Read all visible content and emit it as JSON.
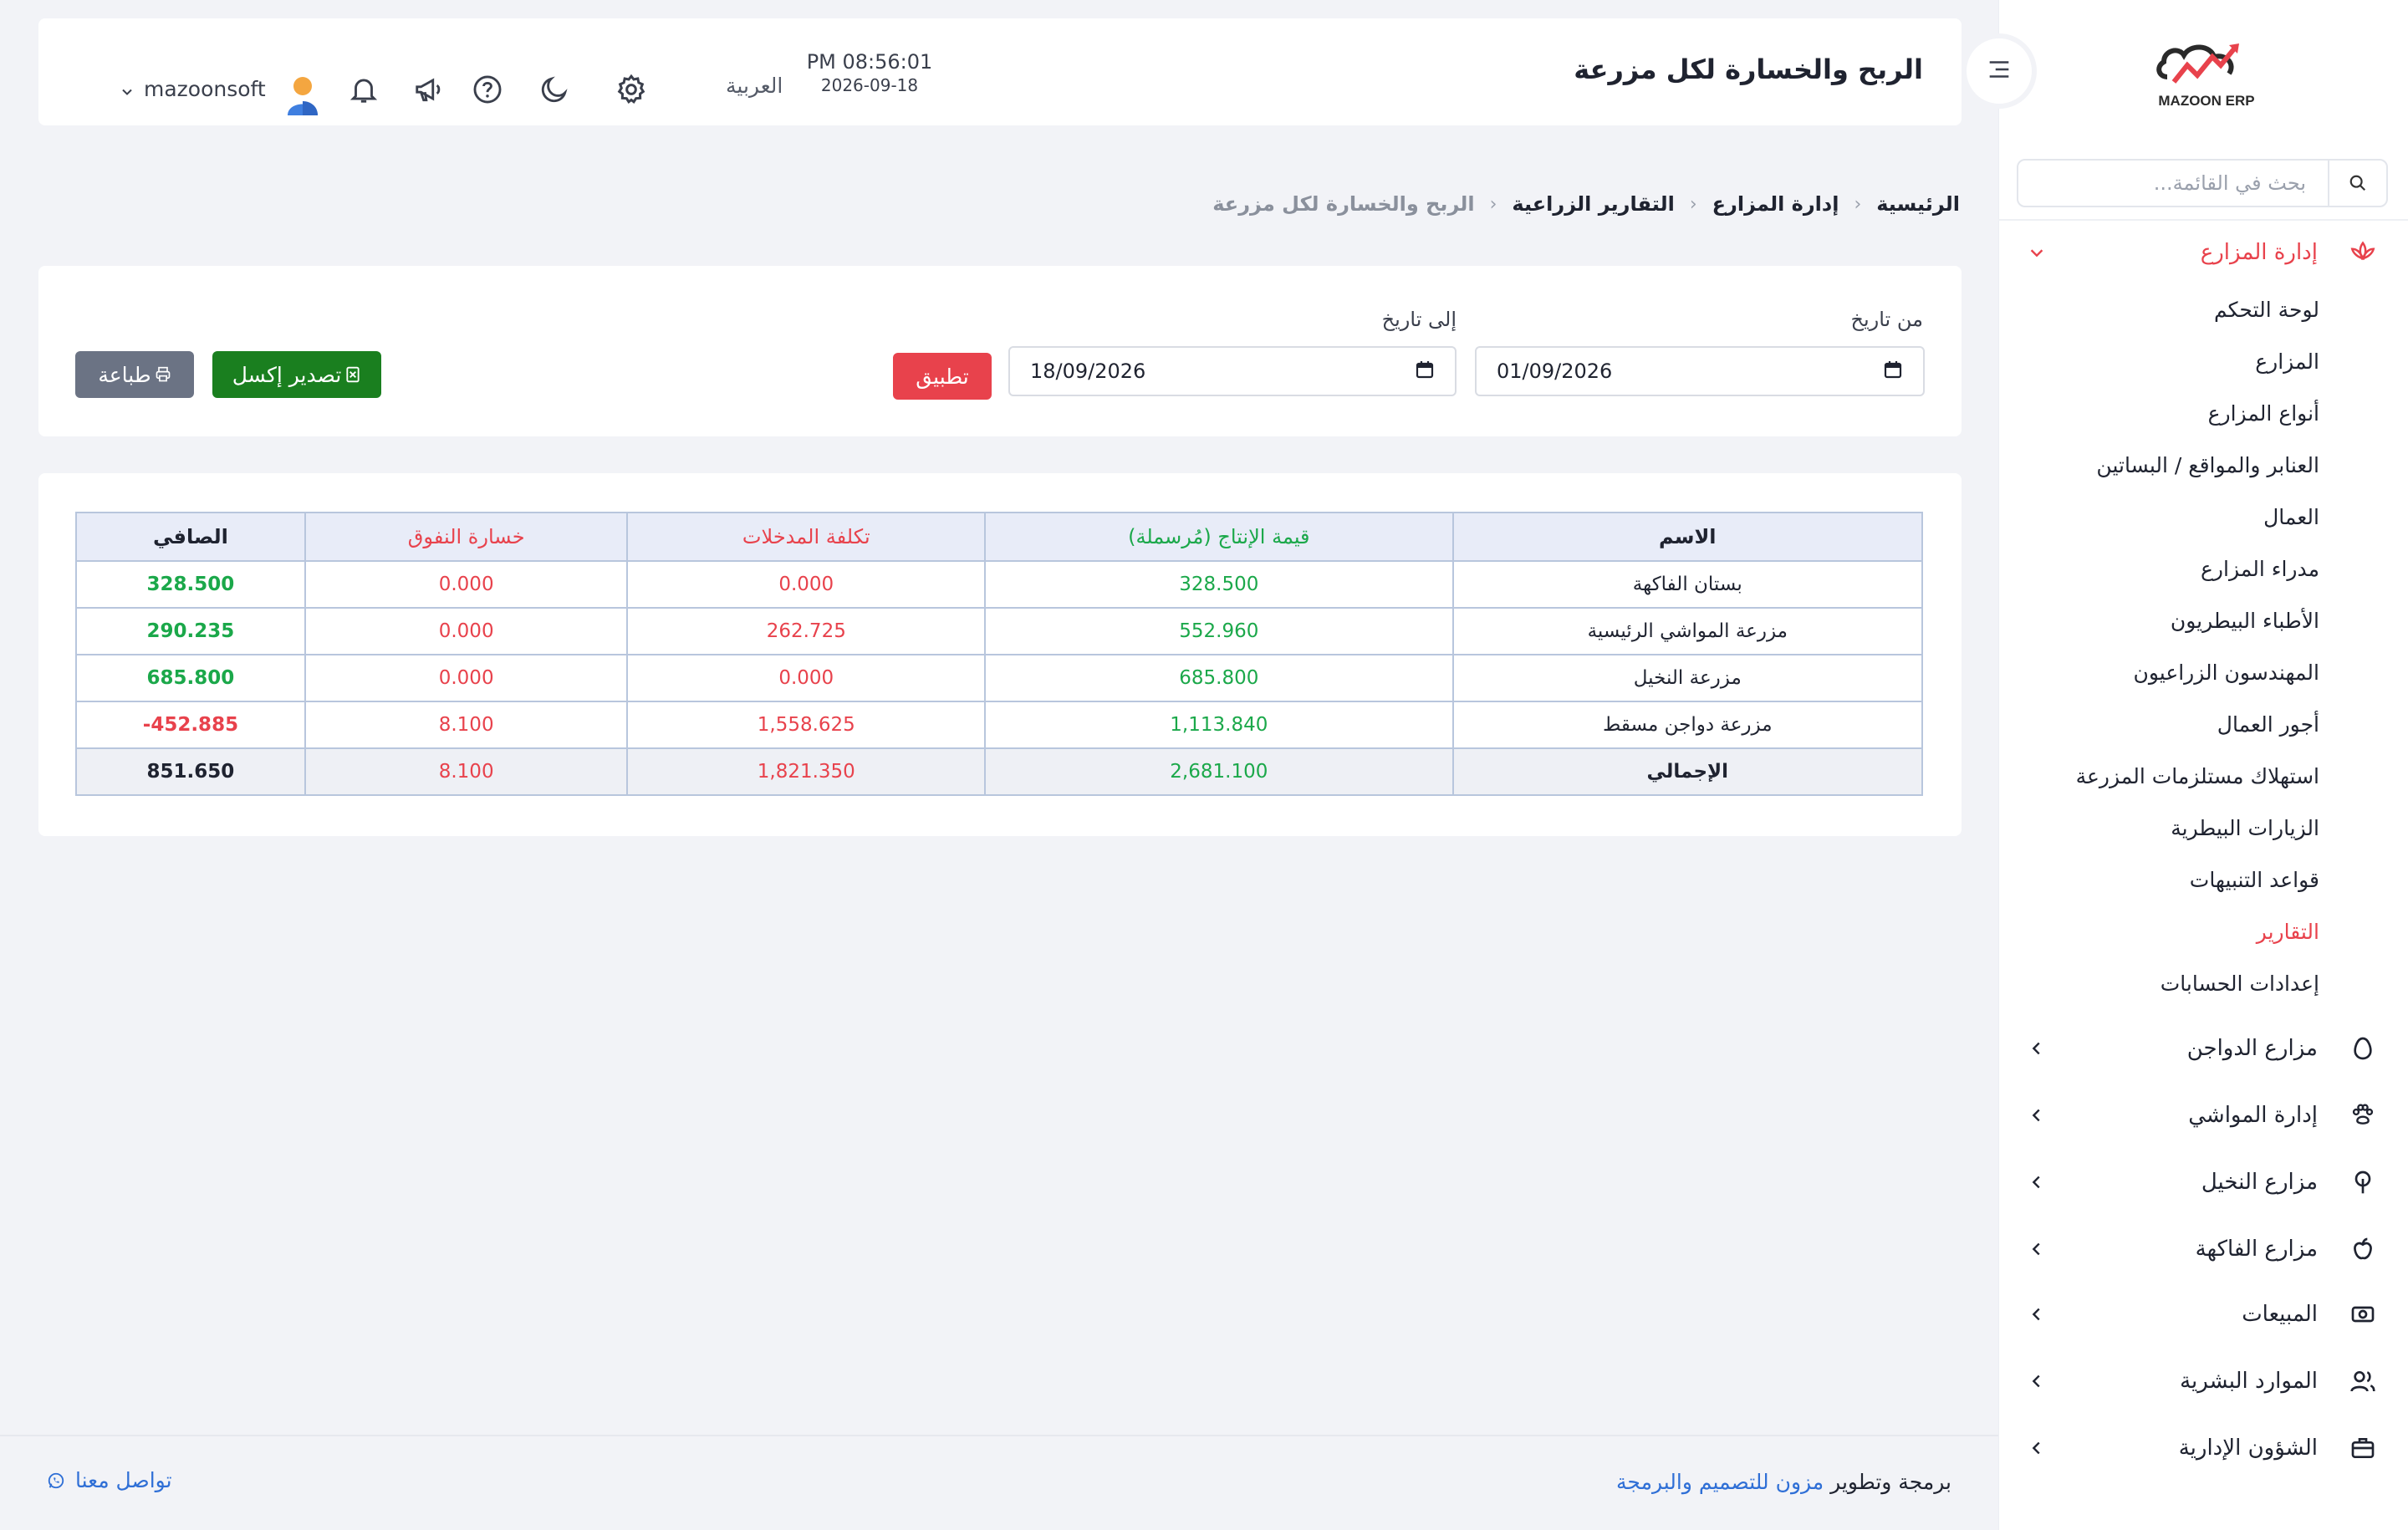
{
  "header": {
    "title": "الربح والخسارة لكل مزرعة",
    "time": "PM 08:56:01",
    "date": "2026-09-18",
    "language": "العربية",
    "username": "mazoonsoft"
  },
  "logo": {
    "text": "MAZOON ERP"
  },
  "sidebar": {
    "search_placeholder": "بحث في القائمة...",
    "sections": [
      {
        "label": "إدارة المزارع",
        "icon": "lotus-icon",
        "expanded": true,
        "active": true
      },
      {
        "label": "مزارع الدواجن",
        "icon": "egg-icon"
      },
      {
        "label": "إدارة المواشي",
        "icon": "paw-icon"
      },
      {
        "label": "مزارع النخيل",
        "icon": "tree-icon"
      },
      {
        "label": "مزارع الفاكهة",
        "icon": "apple-icon"
      },
      {
        "label": "المبيعات",
        "icon": "cash-icon"
      },
      {
        "label": "الموارد البشرية",
        "icon": "users-icon"
      },
      {
        "label": "الشؤون الإدارية",
        "icon": "briefcase-icon"
      }
    ],
    "submenu": [
      "لوحة التحكم",
      "المزارع",
      "أنواع المزارع",
      "العنابر والمواقع / البساتين",
      "العمال",
      "مدراء المزارع",
      "الأطباء البيطريون",
      "المهندسون الزراعيون",
      "أجور العمال",
      "استهلاك مستلزمات المزرعة",
      "الزيارات البيطرية",
      "قواعد التنبيهات",
      "التقارير",
      "إعدادات الحسابات"
    ],
    "active_submenu": "التقارير"
  },
  "breadcrumb": [
    "الرئيسية",
    "إدارة المزارع",
    "التقارير الزراعية",
    "الربح والخسارة لكل مزرعة"
  ],
  "filters": {
    "from_label": "من تاريخ",
    "from_value": "01/09/2026",
    "to_label": "إلى تاريخ",
    "to_value": "18/09/2026",
    "apply_label": "تطبيق",
    "excel_label": "تصدير إكسل",
    "print_label": "طباعة"
  },
  "table": {
    "headers": {
      "name": "الاسم",
      "production": "قيمة الإنتاج (مُرسملة)",
      "input_cost": "تكلفة المدخلات",
      "mortality_loss": "خسارة النفوق",
      "net": "الصافي"
    },
    "rows": [
      {
        "name": "بستان الفاكهة",
        "production": "328.500",
        "input_cost": "0.000",
        "mortality_loss": "0.000",
        "net": "328.500",
        "net_negative": false
      },
      {
        "name": "مزرعة المواشي الرئيسية",
        "production": "552.960",
        "input_cost": "262.725",
        "mortality_loss": "0.000",
        "net": "290.235",
        "net_negative": false
      },
      {
        "name": "مزرعة النخيل",
        "production": "685.800",
        "input_cost": "0.000",
        "mortality_loss": "0.000",
        "net": "685.800",
        "net_negative": false
      },
      {
        "name": "مزرعة دواجن مسقط",
        "production": "1,113.840",
        "input_cost": "1,558.625",
        "mortality_loss": "8.100",
        "net": "452.885-",
        "net_negative": true
      }
    ],
    "total": {
      "name": "الإجمالي",
      "production": "2,681.100",
      "input_cost": "1,821.350",
      "mortality_loss": "8.100",
      "net": "851.650"
    }
  },
  "footer": {
    "credit_prefix": "برمجة وتطوير",
    "credit_link": "مزون للتصميم والبرمجة",
    "contact": "تواصل معنا"
  },
  "colors": {
    "accent_red": "#e8424c",
    "green": "#1ba84a",
    "excel_green": "#1a7f1f",
    "print_gray": "#6b7384",
    "link_blue": "#2f6fd6"
  }
}
